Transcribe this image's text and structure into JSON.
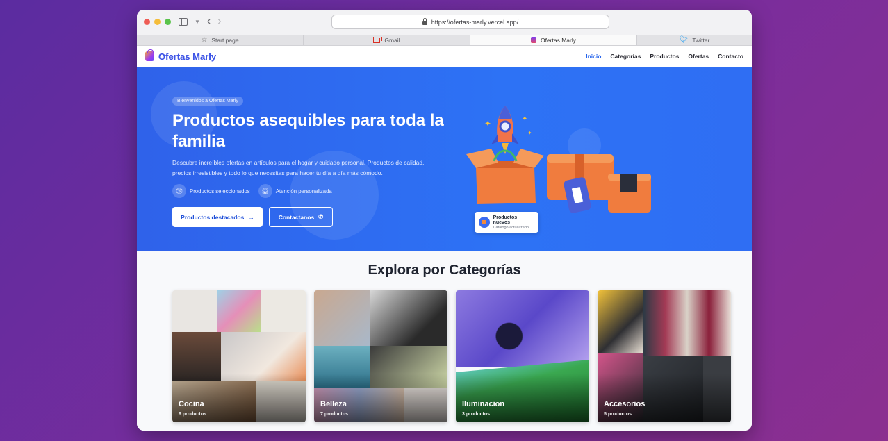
{
  "browser": {
    "url": "https://ofertas-marly.vercel.app/",
    "tabs": [
      {
        "label": "Start page",
        "icon": "star-icon"
      },
      {
        "label": "Gmail",
        "icon": "gmail-icon"
      },
      {
        "label": "Ofertas Marly",
        "icon": "shopping-bag-icon",
        "active": true
      },
      {
        "label": "Twitter",
        "icon": "twitter-icon"
      }
    ]
  },
  "header": {
    "brand": "Ofertas Marly",
    "nav": [
      {
        "label": "Inicio",
        "active": true
      },
      {
        "label": "Categorías"
      },
      {
        "label": "Productos"
      },
      {
        "label": "Ofertas"
      },
      {
        "label": "Contacto"
      }
    ]
  },
  "hero": {
    "pill": "Bienvenidos a Ofertas Marly",
    "title": "Productos asequibles para toda la familia",
    "description": "Descubre increíbles ofertas en artículos para el hogar y cuidado personal. Productos de calidad, precios irresistibles y todo lo que necesitas para hacer tu día a día más cómodo.",
    "features": [
      {
        "label": "Productos seleccionados",
        "icon": "box-icon"
      },
      {
        "label": "Atención personalizada",
        "icon": "headset-icon"
      }
    ],
    "primary_cta": "Productos destacados",
    "secondary_cta": "Contactanos",
    "new_card": {
      "title": "Productos nuevos",
      "subtitle": "Catálogo actualizado"
    }
  },
  "categories": {
    "title": "Explora por Categorías",
    "items": [
      {
        "name": "Cocina",
        "count": "9 productos"
      },
      {
        "name": "Belleza",
        "count": "7 productos"
      },
      {
        "name": "Iluminacion",
        "count": "3 productos"
      },
      {
        "name": "Accesorios",
        "count": "5 productos"
      }
    ]
  },
  "colors": {
    "accent": "#2563eb",
    "hero_bg": "#2d6bf2",
    "page_bg": "#6b2d9e"
  }
}
